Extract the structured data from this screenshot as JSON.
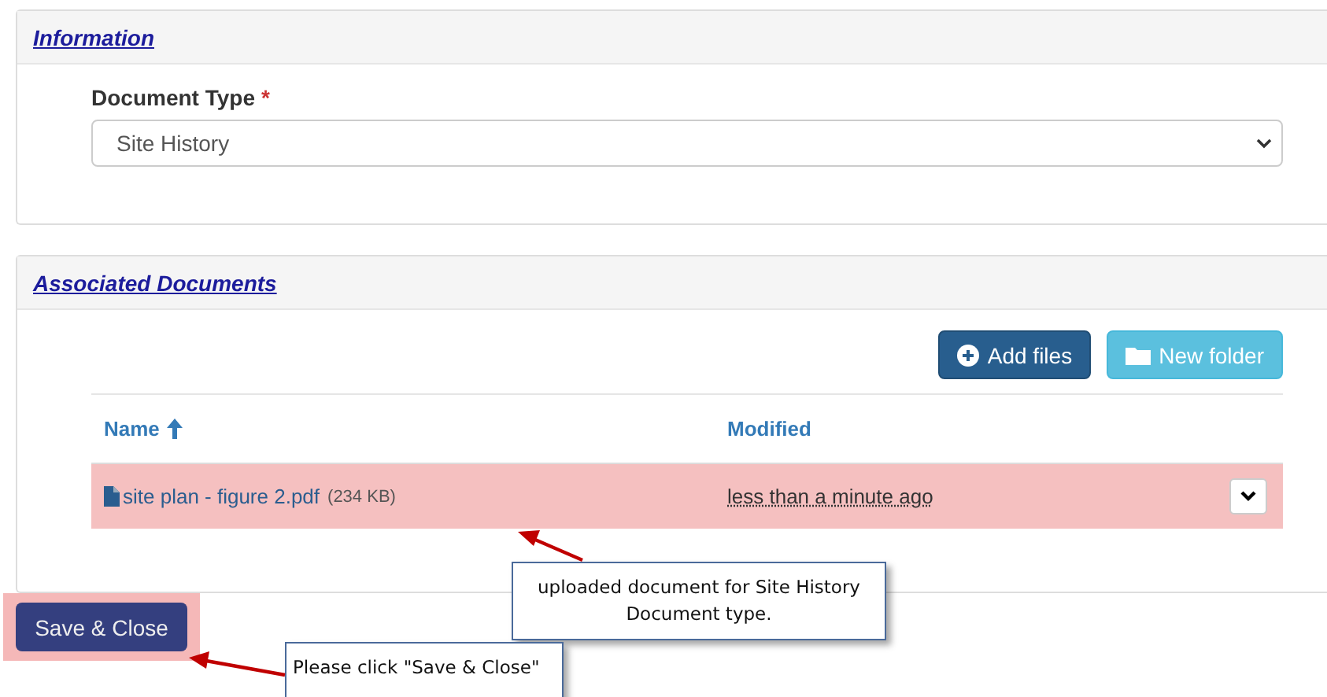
{
  "information": {
    "title": "Information",
    "document_type": {
      "label": "Document Type",
      "required_mark": "*",
      "value": "Site History"
    }
  },
  "associated_documents": {
    "title": "Associated Documents",
    "buttons": [
      {
        "label": "Add files",
        "kind": "primary"
      },
      {
        "label": "New folder",
        "kind": "info"
      }
    ],
    "columns": [
      {
        "label": "Name",
        "sorted": true
      },
      {
        "label": "Modified",
        "sorted": false
      }
    ],
    "rows": [
      {
        "name": "site plan - figure 2.pdf",
        "size": "(234 KB)",
        "modified": "less than a minute ago",
        "highlighted": true
      }
    ]
  },
  "save_button": {
    "label": "Save & Close",
    "highlighted": true
  },
  "callouts": [
    {
      "text": "uploaded document for Site History Document type."
    },
    {
      "text": "Please click \"Save & Close\""
    }
  ]
}
